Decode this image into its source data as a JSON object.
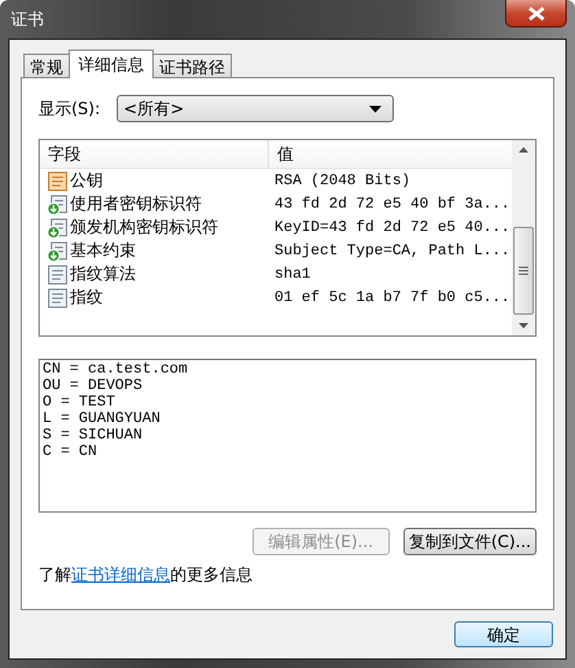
{
  "window": {
    "title": "证书"
  },
  "tabs": [
    {
      "label": "常规",
      "selected": false
    },
    {
      "label": "详细信息",
      "selected": true
    },
    {
      "label": "证书路径",
      "selected": false
    }
  ],
  "show": {
    "label": "显示(S):",
    "value": "<所有>"
  },
  "table": {
    "columns": [
      "字段",
      "值"
    ],
    "rows": [
      {
        "kind": "key",
        "field": "公钥",
        "value": "RSA (2048 Bits)"
      },
      {
        "kind": "extension",
        "field": "使用者密钥标识符",
        "value": "43 fd 2d 72 e5 40 bf 3a..."
      },
      {
        "kind": "extension",
        "field": "颁发机构密钥标识符",
        "value": "KeyID=43 fd 2d 72 e5 40..."
      },
      {
        "kind": "extension",
        "field": "基本约束",
        "value": "Subject Type=CA, Path L..."
      },
      {
        "kind": "property",
        "field": "指纹算法",
        "value": "sha1"
      },
      {
        "kind": "property",
        "field": "指纹",
        "value": "01 ef 5c 1a b7 7f b0 c5..."
      }
    ]
  },
  "detail_lines": [
    "CN = ca.test.com",
    "OU = DEVOPS",
    "O = TEST",
    "L = GUANGYUAN",
    "S = SICHUAN",
    "C = CN"
  ],
  "buttons": [
    {
      "label": "编辑属性(E)...",
      "disabled": true
    },
    {
      "label": "复制到文件(C)...",
      "disabled": false
    }
  ],
  "learn_more": {
    "before": "了解",
    "link": "证书详细信息",
    "after": "的更多信息"
  },
  "ok_button": "确定"
}
